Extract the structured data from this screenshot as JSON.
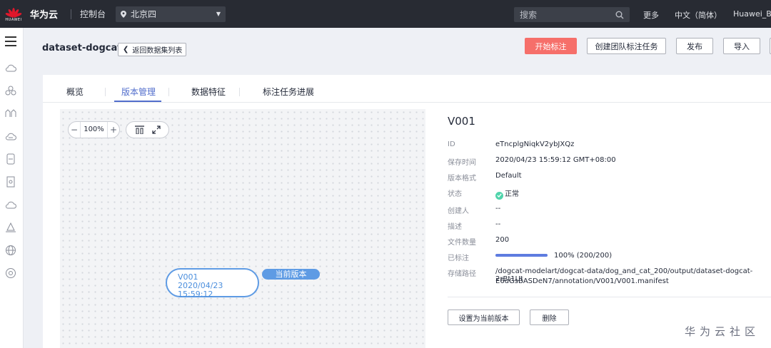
{
  "topbar": {
    "logo_text": "HUAWEI",
    "brand": "华为云",
    "console": "控制台",
    "region": "北京四",
    "search_placeholder": "搜索",
    "more": "更多",
    "language": "中文（简体）",
    "user": "Huawei_Bin"
  },
  "header": {
    "dataset_title": "dataset-dogcat",
    "back_label": "返回数据集列表",
    "start_label": "开始标注",
    "team_task_label": "创建团队标注任务",
    "publish_label": "发布",
    "import_label": "导入"
  },
  "tabs": [
    {
      "label": "概览"
    },
    {
      "label": "版本管理"
    },
    {
      "label": "数据特征"
    },
    {
      "label": "标注任务进展"
    }
  ],
  "canvas": {
    "zoom_value": "100%",
    "zoom_minus": "−",
    "zoom_plus": "+",
    "node_version": "V001",
    "node_time": "2020/04/23 15:59:12",
    "current_badge": "当前版本"
  },
  "details": {
    "title": "V001",
    "rows": [
      {
        "label": "ID",
        "value": "eTncplgNiqkV2ybJXQz"
      },
      {
        "label": "保存时间",
        "value": "2020/04/23 15:59:12 GMT+08:00"
      },
      {
        "label": "版本格式",
        "value": "Default"
      },
      {
        "label": "状态",
        "value": "正常"
      },
      {
        "label": "创建人",
        "value": "--"
      },
      {
        "label": "描述",
        "value": "--"
      },
      {
        "label": "文件数量",
        "value": "200"
      },
      {
        "label": "已标注",
        "value": "100% (200/200)"
      },
      {
        "label": "存储路径",
        "value": "/dogcat-modelart/dogcat-data/dog_and_cat_200/output/dataset-dogcat-2rBt1Ut",
        "value2": "E6uGsBASDeN7/annotation/V001/V001.manifest"
      }
    ],
    "labeled_fraction": 1.0,
    "set_current_label": "设置为当前版本",
    "delete_label": "删除"
  },
  "watermark": "华为云社区",
  "colors": {
    "topbar_bg": "#282b33",
    "primary_button": "#f66f6a",
    "tab_active": "#526ecc",
    "node_blue": "#5e9be4",
    "status_ok": "#50d4ab",
    "progress": "#5e7ce0"
  }
}
